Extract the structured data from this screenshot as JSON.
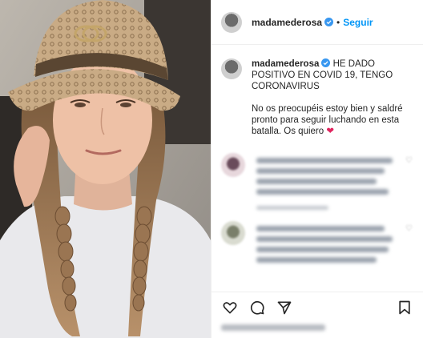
{
  "header": {
    "username": "madamederosa",
    "separator": "•",
    "follow_label": "Seguir"
  },
  "caption": {
    "username": "madamederosa",
    "headline": "HE DADO POSITIVO EN COVID 19, TENGO CORONAVIRUS",
    "body": "No os preocupéis estoy bien y saldré pronto para seguir luchando en esta batalla. Os quiero",
    "emoji": "❤"
  },
  "icons": {
    "verified": "verified-badge-icon",
    "like": "heart-icon",
    "comment": "comment-icon",
    "share": "share-icon",
    "save": "bookmark-icon"
  },
  "colors": {
    "accent": "#0095f6",
    "verified": "#3897f0",
    "heart": "#e0245e",
    "text": "#262626",
    "border": "#efefef"
  }
}
